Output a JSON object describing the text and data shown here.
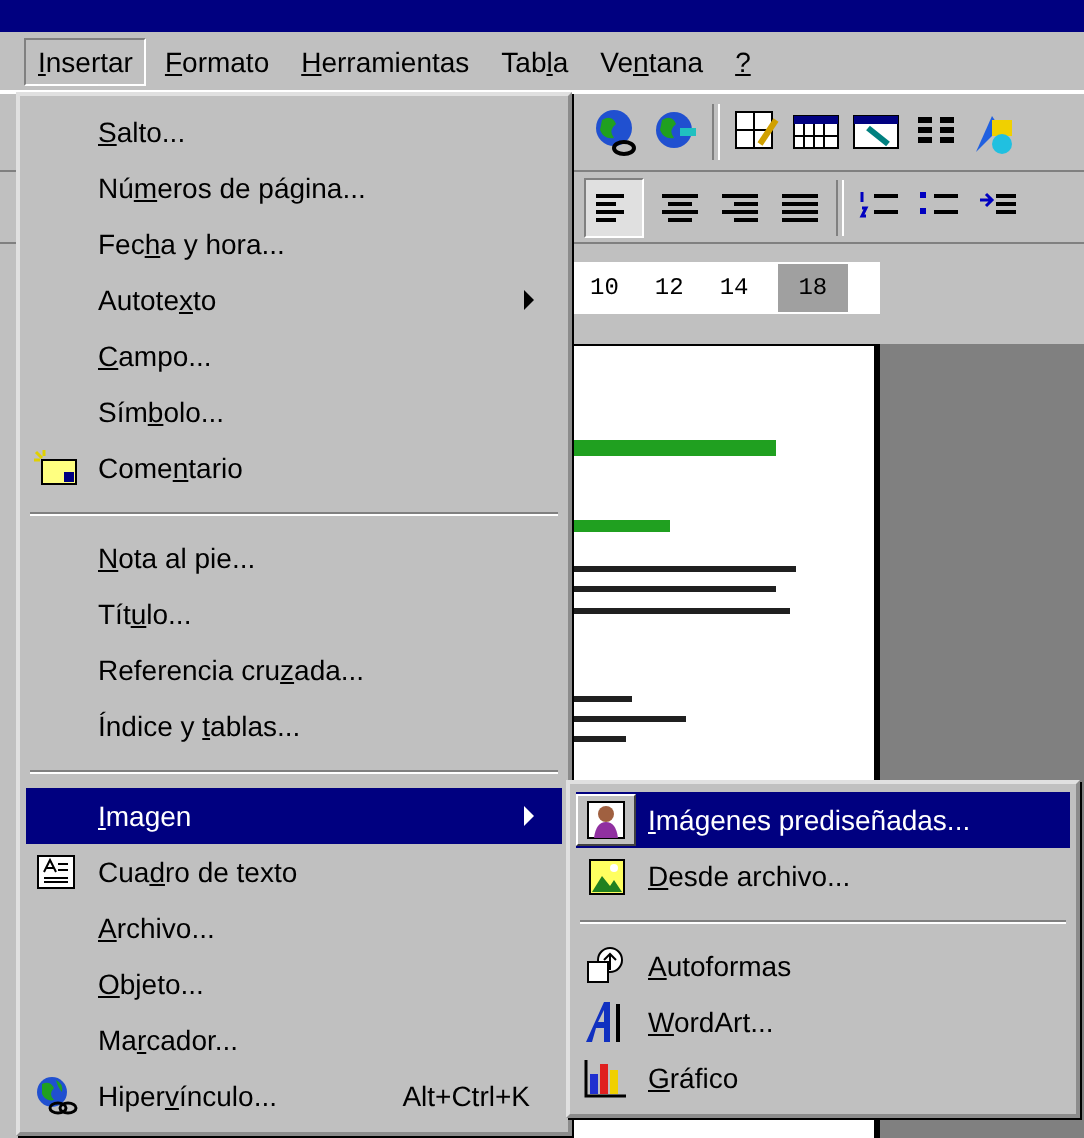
{
  "menu_bar": [
    {
      "label": {
        "key": "I",
        "after": "nsertar"
      },
      "selected": true
    },
    {
      "label": {
        "key": "F",
        "after": "ormato"
      },
      "selected": false
    },
    {
      "label": {
        "key": "H",
        "after": "erramientas"
      },
      "selected": false
    },
    {
      "label": {
        "before": "Tab",
        "key": "l",
        "after": "a"
      },
      "selected": false
    },
    {
      "label": {
        "before": "Ve",
        "key": "n",
        "after": "tana"
      },
      "selected": false
    },
    {
      "label": {
        "key": "?"
      },
      "selected": false
    }
  ],
  "font_size_list": [
    {
      "text": "10",
      "selected": false
    },
    {
      "text": "12",
      "selected": false
    },
    {
      "text": "14",
      "selected": false
    },
    {
      "text": "18",
      "selected": true
    }
  ],
  "insert_menu": [
    {
      "kind": "command",
      "label": {
        "key": "S",
        "after": "alto..."
      },
      "selected": false
    },
    {
      "kind": "command",
      "label": {
        "before": "Nú",
        "key": "m",
        "after": "eros de página..."
      },
      "selected": false
    },
    {
      "kind": "command",
      "label": {
        "before": "Fec",
        "key": "h",
        "after": "a y hora..."
      },
      "selected": false
    },
    {
      "kind": "submenu",
      "label": {
        "before": "Autote",
        "key": "x",
        "after": "to"
      },
      "selected": false
    },
    {
      "kind": "command",
      "label": {
        "key": "C",
        "after": "ampo..."
      },
      "selected": false
    },
    {
      "kind": "command",
      "label": {
        "before": "Sím",
        "key": "b",
        "after": "olo..."
      },
      "selected": false
    },
    {
      "kind": "command",
      "label": {
        "before": "Come",
        "key": "n",
        "after": "tario"
      },
      "selected": false
    },
    {
      "kind": "separator"
    },
    {
      "kind": "command",
      "label": {
        "key": "N",
        "after": "ota al pie..."
      },
      "selected": false
    },
    {
      "kind": "command",
      "label": {
        "before": "Tít",
        "key": "u",
        "after": "lo..."
      },
      "selected": false
    },
    {
      "kind": "command",
      "label": {
        "before": "Referencia cru",
        "key": "z",
        "after": "ada..."
      },
      "selected": false
    },
    {
      "kind": "command",
      "label": {
        "before": "Índice y ",
        "key": "t",
        "after": "ablas..."
      },
      "selected": false
    },
    {
      "kind": "separator"
    },
    {
      "kind": "submenu",
      "label": {
        "key": "I",
        "after": "magen"
      },
      "selected": true
    },
    {
      "kind": "command",
      "label": {
        "before": "Cua",
        "key": "d",
        "after": "ro de texto"
      },
      "selected": false
    },
    {
      "kind": "command",
      "label": {
        "key": "A",
        "after": "rchivo..."
      },
      "selected": false
    },
    {
      "kind": "command",
      "label": {
        "key": "O",
        "after": "bjeto..."
      },
      "selected": false
    },
    {
      "kind": "command",
      "label": {
        "before": "Ma",
        "key": "r",
        "after": "cador..."
      },
      "selected": false
    },
    {
      "kind": "command",
      "label": {
        "before": "Hiper",
        "key": "v",
        "after": "ínculo..."
      },
      "shortcut": "Alt+Ctrl+K",
      "selected": false
    }
  ],
  "image_submenu": [
    {
      "kind": "command",
      "label": {
        "key": "I",
        "after": "mágenes prediseñadas..."
      },
      "selected": true
    },
    {
      "kind": "command",
      "label": {
        "key": "D",
        "after": "esde archivo..."
      },
      "selected": false
    },
    {
      "kind": "separator"
    },
    {
      "kind": "command",
      "label": {
        "key": "A",
        "after": "utoformas"
      },
      "selected": false
    },
    {
      "kind": "command",
      "label": {
        "key": "W",
        "after": "ordArt..."
      },
      "selected": false
    },
    {
      "kind": "command",
      "label": {
        "key": "G",
        "after": "ráfico"
      },
      "selected": false
    }
  ]
}
